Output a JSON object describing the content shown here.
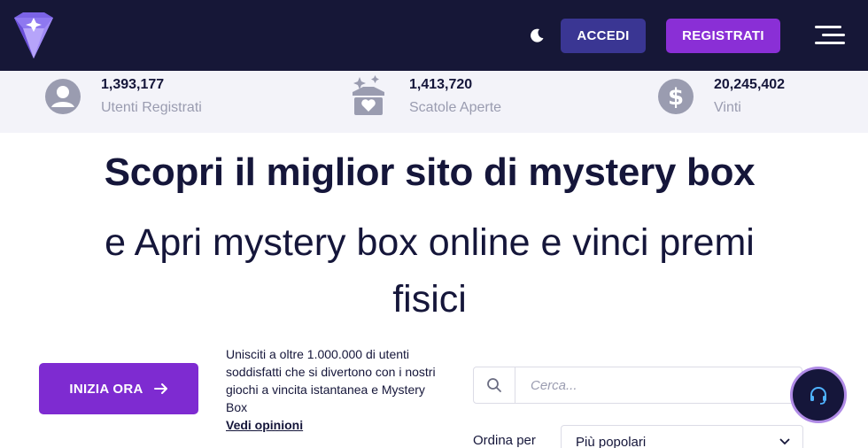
{
  "header": {
    "login_label": "ACCEDI",
    "register_label": "REGISTRATI",
    "icons": {
      "logo": "diamond-logo",
      "theme_toggle": "moon-icon",
      "menu": "hamburger-icon"
    }
  },
  "stats": [
    {
      "value": "1,393,177",
      "label": "Utenti Registrati",
      "icon": "user-icon"
    },
    {
      "value": "1,413,720",
      "label": "Scatole Aperte",
      "icon": "box-heart-icon"
    },
    {
      "value": "20,245,402",
      "label": "Vinti",
      "icon": "dollar-icon"
    }
  ],
  "hero": {
    "title": "Scopri il miglior sito di mystery box",
    "subtitle": "e Apri mystery box online e vinci premi fisici"
  },
  "cta": {
    "start_label": "INIZIA ORA",
    "promo_text": "Unisciti a oltre 1.000.000 di utenti soddisfatti che si divertono con i nostri giochi a vincita istantanea e Mystery Box",
    "reviews_link": "Vedi opinioni"
  },
  "search": {
    "placeholder": "Cerca..."
  },
  "sort": {
    "label": "Ordina per",
    "selected": "Più popolari"
  },
  "colors": {
    "header_bg": "#161737",
    "accent_purple": "#8a2fd6",
    "login_blue": "#3a3693",
    "text_dark": "#15163a",
    "muted": "#9a9cb0",
    "stats_bg": "#f3f3f9"
  }
}
